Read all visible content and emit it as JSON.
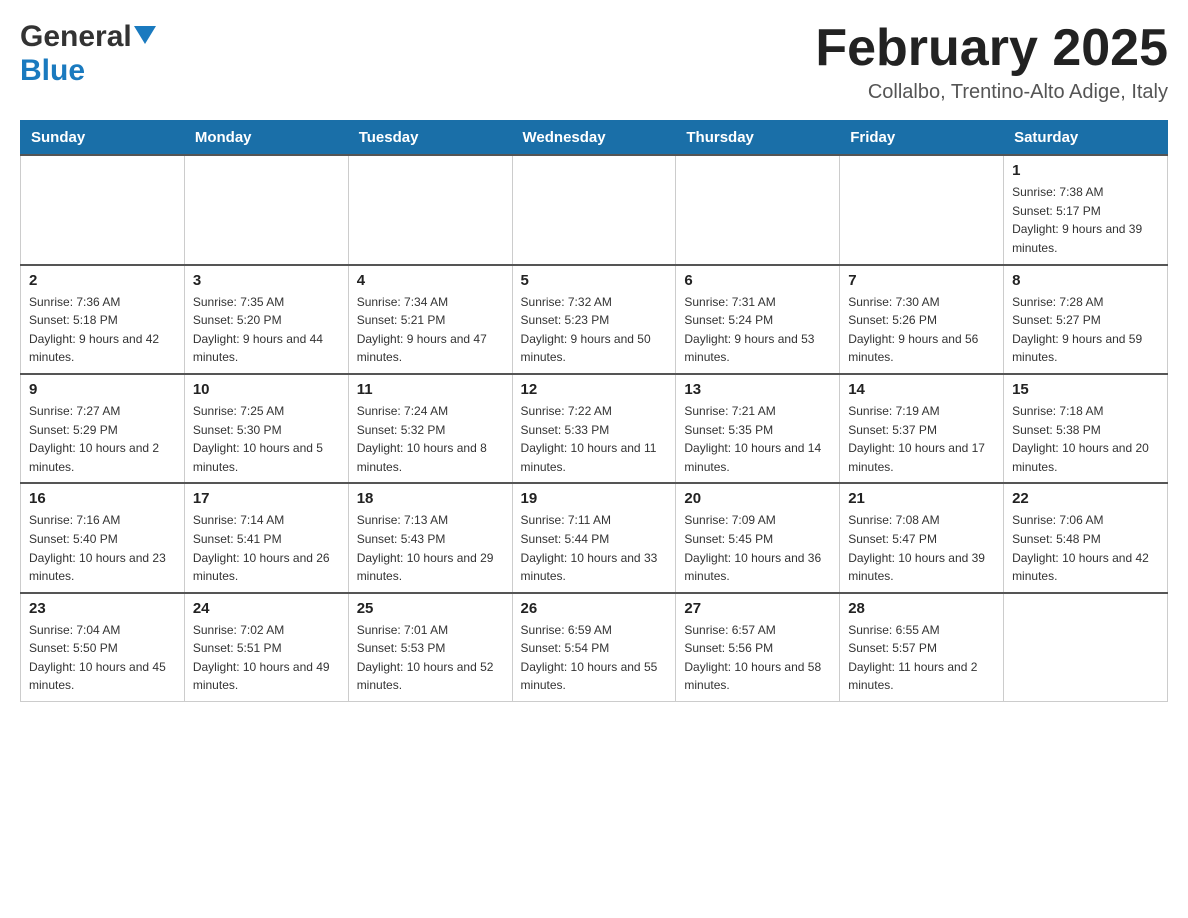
{
  "header": {
    "logo_general": "General",
    "logo_blue": "Blue",
    "title": "February 2025",
    "subtitle": "Collalbo, Trentino-Alto Adige, Italy"
  },
  "days_of_week": [
    "Sunday",
    "Monday",
    "Tuesday",
    "Wednesday",
    "Thursday",
    "Friday",
    "Saturday"
  ],
  "weeks": [
    [
      {
        "day": "",
        "info": ""
      },
      {
        "day": "",
        "info": ""
      },
      {
        "day": "",
        "info": ""
      },
      {
        "day": "",
        "info": ""
      },
      {
        "day": "",
        "info": ""
      },
      {
        "day": "",
        "info": ""
      },
      {
        "day": "1",
        "info": "Sunrise: 7:38 AM\nSunset: 5:17 PM\nDaylight: 9 hours and 39 minutes."
      }
    ],
    [
      {
        "day": "2",
        "info": "Sunrise: 7:36 AM\nSunset: 5:18 PM\nDaylight: 9 hours and 42 minutes."
      },
      {
        "day": "3",
        "info": "Sunrise: 7:35 AM\nSunset: 5:20 PM\nDaylight: 9 hours and 44 minutes."
      },
      {
        "day": "4",
        "info": "Sunrise: 7:34 AM\nSunset: 5:21 PM\nDaylight: 9 hours and 47 minutes."
      },
      {
        "day": "5",
        "info": "Sunrise: 7:32 AM\nSunset: 5:23 PM\nDaylight: 9 hours and 50 minutes."
      },
      {
        "day": "6",
        "info": "Sunrise: 7:31 AM\nSunset: 5:24 PM\nDaylight: 9 hours and 53 minutes."
      },
      {
        "day": "7",
        "info": "Sunrise: 7:30 AM\nSunset: 5:26 PM\nDaylight: 9 hours and 56 minutes."
      },
      {
        "day": "8",
        "info": "Sunrise: 7:28 AM\nSunset: 5:27 PM\nDaylight: 9 hours and 59 minutes."
      }
    ],
    [
      {
        "day": "9",
        "info": "Sunrise: 7:27 AM\nSunset: 5:29 PM\nDaylight: 10 hours and 2 minutes."
      },
      {
        "day": "10",
        "info": "Sunrise: 7:25 AM\nSunset: 5:30 PM\nDaylight: 10 hours and 5 minutes."
      },
      {
        "day": "11",
        "info": "Sunrise: 7:24 AM\nSunset: 5:32 PM\nDaylight: 10 hours and 8 minutes."
      },
      {
        "day": "12",
        "info": "Sunrise: 7:22 AM\nSunset: 5:33 PM\nDaylight: 10 hours and 11 minutes."
      },
      {
        "day": "13",
        "info": "Sunrise: 7:21 AM\nSunset: 5:35 PM\nDaylight: 10 hours and 14 minutes."
      },
      {
        "day": "14",
        "info": "Sunrise: 7:19 AM\nSunset: 5:37 PM\nDaylight: 10 hours and 17 minutes."
      },
      {
        "day": "15",
        "info": "Sunrise: 7:18 AM\nSunset: 5:38 PM\nDaylight: 10 hours and 20 minutes."
      }
    ],
    [
      {
        "day": "16",
        "info": "Sunrise: 7:16 AM\nSunset: 5:40 PM\nDaylight: 10 hours and 23 minutes."
      },
      {
        "day": "17",
        "info": "Sunrise: 7:14 AM\nSunset: 5:41 PM\nDaylight: 10 hours and 26 minutes."
      },
      {
        "day": "18",
        "info": "Sunrise: 7:13 AM\nSunset: 5:43 PM\nDaylight: 10 hours and 29 minutes."
      },
      {
        "day": "19",
        "info": "Sunrise: 7:11 AM\nSunset: 5:44 PM\nDaylight: 10 hours and 33 minutes."
      },
      {
        "day": "20",
        "info": "Sunrise: 7:09 AM\nSunset: 5:45 PM\nDaylight: 10 hours and 36 minutes."
      },
      {
        "day": "21",
        "info": "Sunrise: 7:08 AM\nSunset: 5:47 PM\nDaylight: 10 hours and 39 minutes."
      },
      {
        "day": "22",
        "info": "Sunrise: 7:06 AM\nSunset: 5:48 PM\nDaylight: 10 hours and 42 minutes."
      }
    ],
    [
      {
        "day": "23",
        "info": "Sunrise: 7:04 AM\nSunset: 5:50 PM\nDaylight: 10 hours and 45 minutes."
      },
      {
        "day": "24",
        "info": "Sunrise: 7:02 AM\nSunset: 5:51 PM\nDaylight: 10 hours and 49 minutes."
      },
      {
        "day": "25",
        "info": "Sunrise: 7:01 AM\nSunset: 5:53 PM\nDaylight: 10 hours and 52 minutes."
      },
      {
        "day": "26",
        "info": "Sunrise: 6:59 AM\nSunset: 5:54 PM\nDaylight: 10 hours and 55 minutes."
      },
      {
        "day": "27",
        "info": "Sunrise: 6:57 AM\nSunset: 5:56 PM\nDaylight: 10 hours and 58 minutes."
      },
      {
        "day": "28",
        "info": "Sunrise: 6:55 AM\nSunset: 5:57 PM\nDaylight: 11 hours and 2 minutes."
      },
      {
        "day": "",
        "info": ""
      }
    ]
  ]
}
